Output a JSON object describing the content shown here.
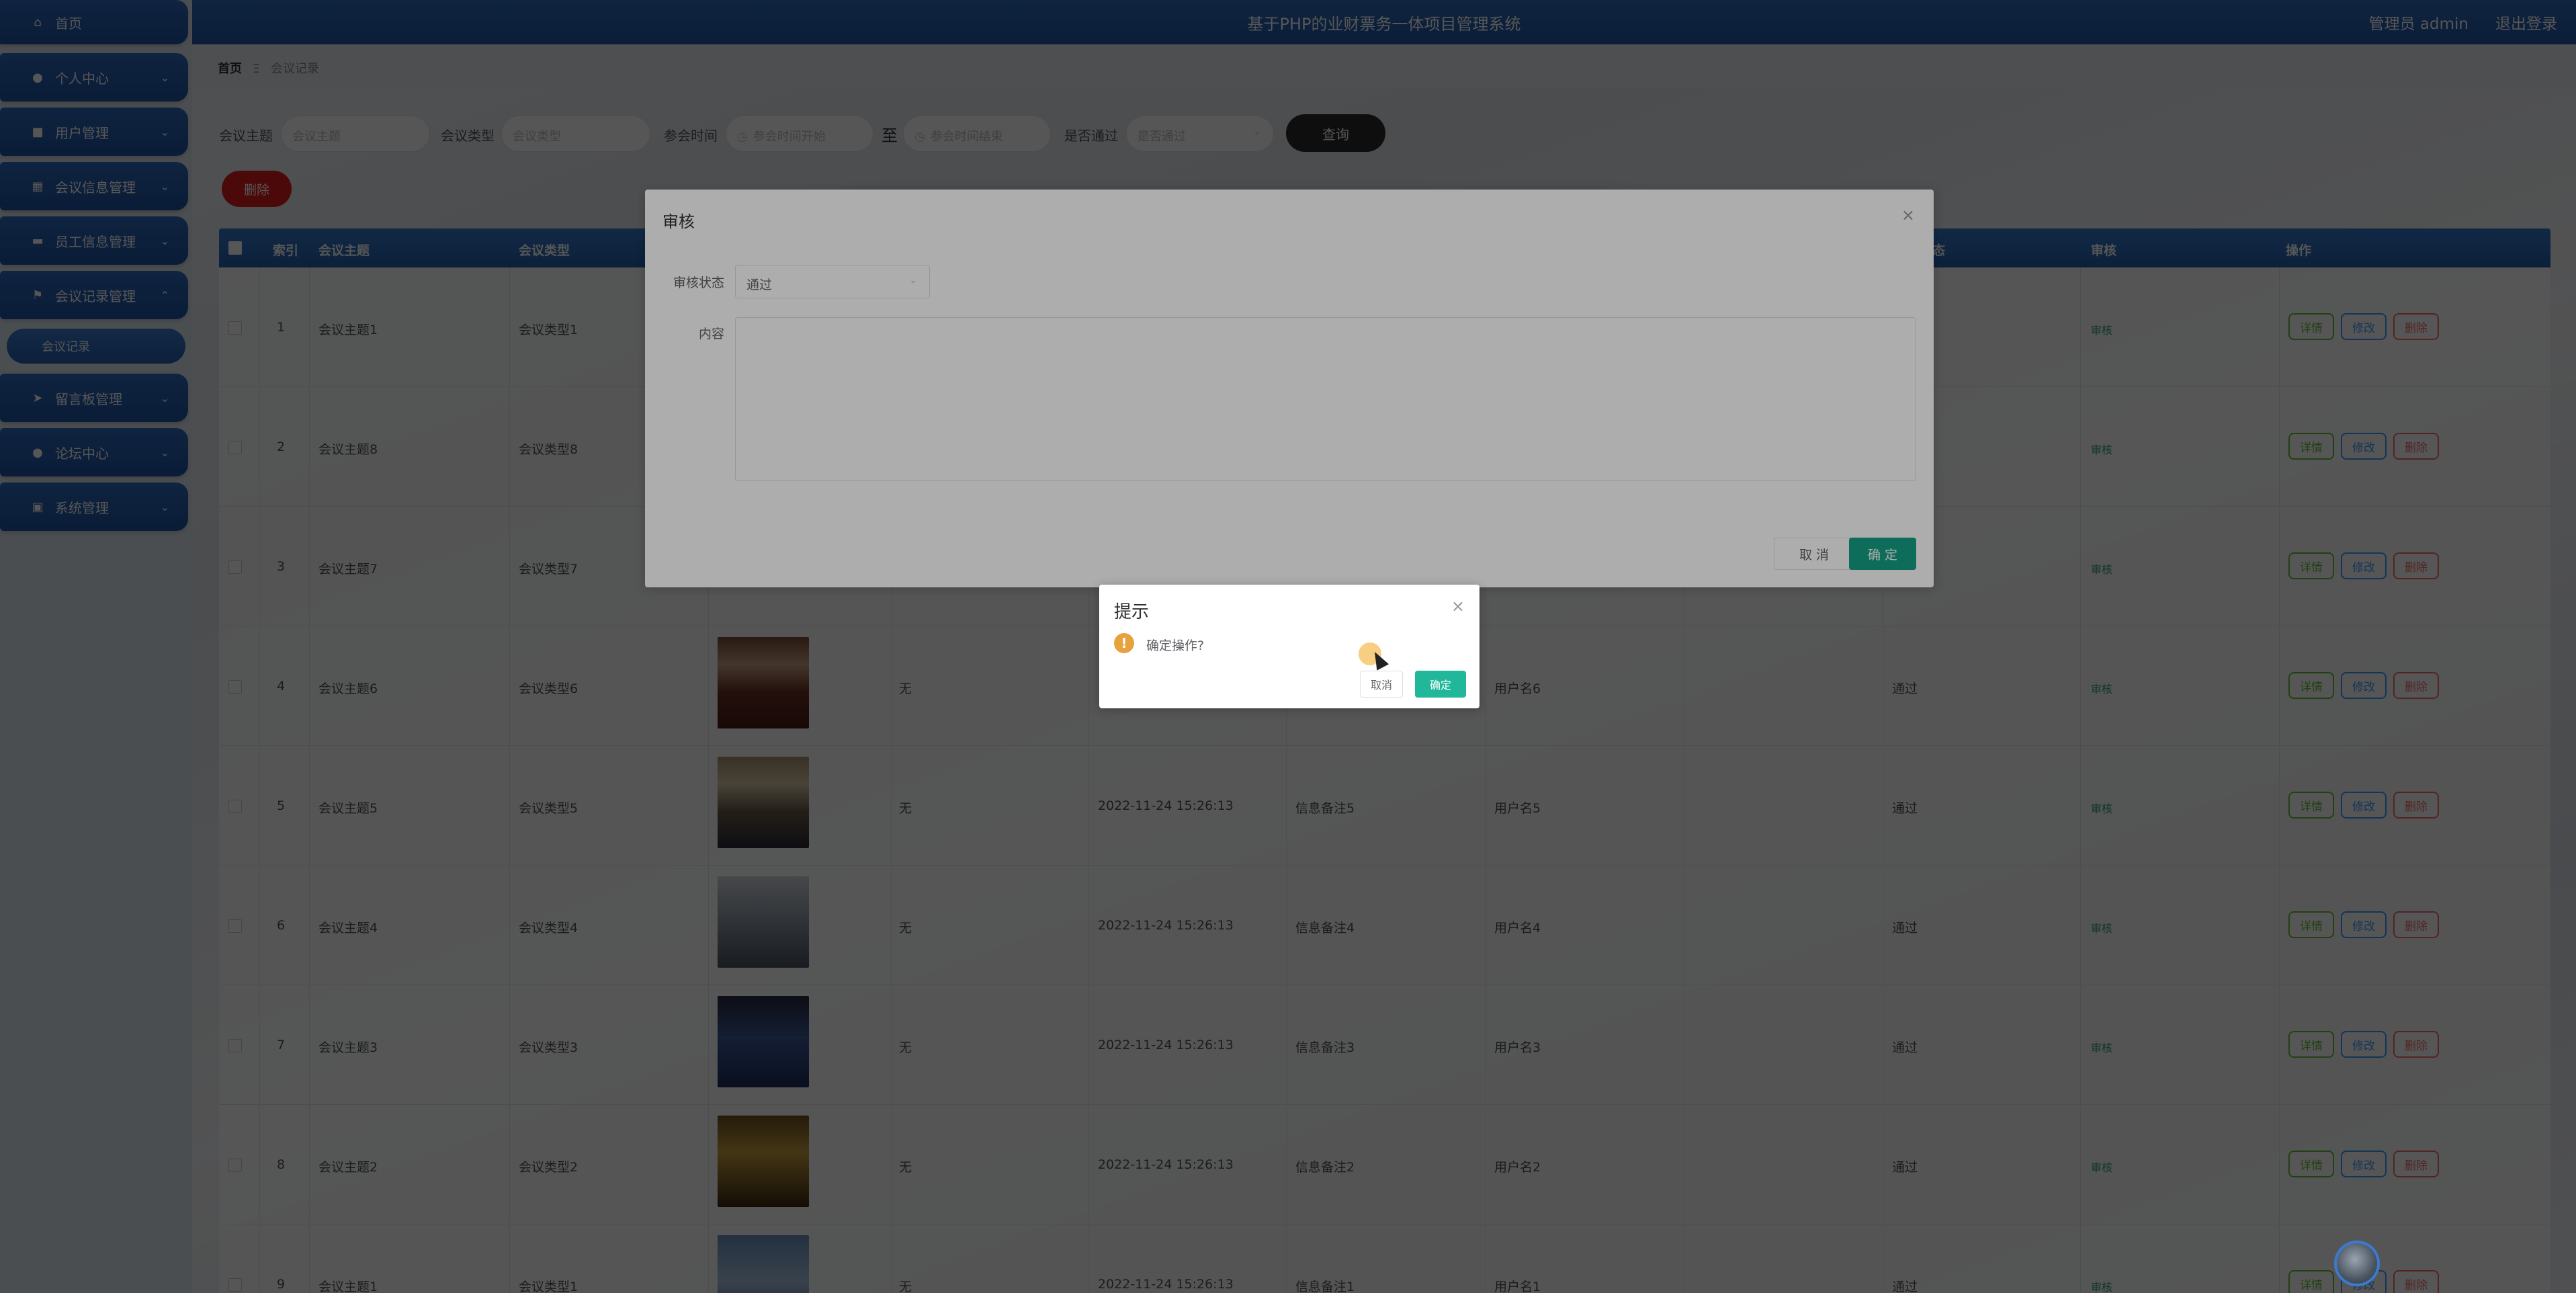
{
  "header": {
    "title": "基于PHP的业财票务一体项目管理系统",
    "user_label": "管理员 admin",
    "logout_label": "退出登录"
  },
  "sidebar": {
    "items": [
      {
        "label": "首页",
        "icon": "home-icon"
      },
      {
        "label": "个人中心",
        "icon": "user-icon"
      },
      {
        "label": "用户管理",
        "icon": "briefcase-icon"
      },
      {
        "label": "会议信息管理",
        "icon": "grid-icon"
      },
      {
        "label": "员工信息管理",
        "icon": "monitor-icon"
      },
      {
        "label": "会议记录管理",
        "icon": "flag-icon"
      },
      {
        "label": "留言板管理",
        "icon": "send-icon"
      },
      {
        "label": "论坛中心",
        "icon": "user-icon"
      },
      {
        "label": "系统管理",
        "icon": "chart-icon"
      }
    ],
    "active_submenu": "会议记录"
  },
  "breadcrumb": {
    "home": "首页",
    "separator": "Ξ",
    "current": "会议记录"
  },
  "search": {
    "topic_label": "会议主题",
    "topic_placeholder": "会议主题",
    "type_label": "会议类型",
    "type_placeholder": "会议类型",
    "time_label": "参会时间",
    "time_start_placeholder": "参会时间开始",
    "time_sep": "至",
    "time_end_placeholder": "参会时间结束",
    "passed_label": "是否通过",
    "passed_placeholder": "是否通过",
    "query_label": "查询"
  },
  "toolbar": {
    "delete_label": "删除"
  },
  "table": {
    "columns": [
      "索引",
      "会议主题",
      "会议类型",
      "审核",
      "操作"
    ],
    "partial_column_tail": "态",
    "rows": [
      {
        "index": "1",
        "topic": "会议主题1",
        "type": "会议类型1",
        "content": "",
        "time": "",
        "remark": "",
        "user": "",
        "passed": "",
        "audit": "审核"
      },
      {
        "index": "2",
        "topic": "会议主题8",
        "type": "会议类型8",
        "content": "",
        "time": "",
        "remark": "",
        "user": "",
        "passed": "",
        "audit": "审核"
      },
      {
        "index": "3",
        "topic": "会议主题7",
        "type": "会议类型7",
        "content": "",
        "time": "",
        "remark": "",
        "user": "",
        "passed": "",
        "audit": "审核"
      },
      {
        "index": "4",
        "topic": "会议主题6",
        "type": "会议类型6",
        "content": "无",
        "time": "",
        "remark": "",
        "user": "用户名6",
        "passed": "通过",
        "audit": "审核"
      },
      {
        "index": "5",
        "topic": "会议主题5",
        "type": "会议类型5",
        "content": "无",
        "time": "2022-11-24 15:26:13",
        "remark": "信息备注5",
        "user": "用户名5",
        "passed": "通过",
        "audit": "审核"
      },
      {
        "index": "6",
        "topic": "会议主题4",
        "type": "会议类型4",
        "content": "无",
        "time": "2022-11-24 15:26:13",
        "remark": "信息备注4",
        "user": "用户名4",
        "passed": "通过",
        "audit": "审核"
      },
      {
        "index": "7",
        "topic": "会议主题3",
        "type": "会议类型3",
        "content": "无",
        "time": "2022-11-24 15:26:13",
        "remark": "信息备注3",
        "user": "用户名3",
        "passed": "通过",
        "audit": "审核"
      },
      {
        "index": "8",
        "topic": "会议主题2",
        "type": "会议类型2",
        "content": "无",
        "time": "2022-11-24 15:26:13",
        "remark": "信息备注2",
        "user": "用户名2",
        "passed": "通过",
        "audit": "审核"
      },
      {
        "index": "9",
        "topic": "会议主题1",
        "type": "会议类型1",
        "content": "无",
        "time": "2022-11-24 15:26:13",
        "remark": "信息备注1",
        "user": "用户名1",
        "passed": "通过",
        "audit": "审核"
      }
    ],
    "ops": {
      "detail": "详情",
      "edit": "修改",
      "delete": "删除"
    }
  },
  "audit_dialog": {
    "title": "审核",
    "status_label": "审核状态",
    "status_value": "通过",
    "content_label": "内容",
    "cancel_label": "取 消",
    "confirm_label": "确 定"
  },
  "confirm_box": {
    "title": "提示",
    "icon": "warning-icon",
    "message": "确定操作?",
    "cancel_label": "取消",
    "ok_label": "确定"
  },
  "colors": {
    "primary": "#2560b0",
    "danger": "#e21c1c",
    "confirm": "#21b79a",
    "warning": "#e6a23c"
  }
}
